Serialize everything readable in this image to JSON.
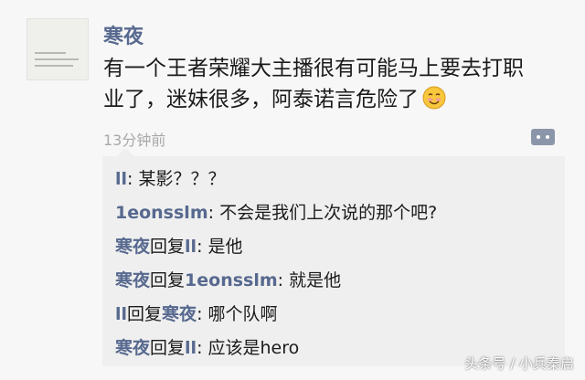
{
  "post": {
    "username": "寒夜",
    "text": "有一个王者荣耀大主播很有可能马上要去打职业了，迷妹很多，阿泰诺言危险了",
    "time": "13分钟前"
  },
  "comments": [
    {
      "name": "ll",
      "reply_word": "",
      "target": "",
      "colon": ": ",
      "text": "某影？？？"
    },
    {
      "name": "1eonsslm",
      "reply_word": "",
      "target": "",
      "colon": ": ",
      "text": "不会是我们上次说的那个吧?"
    },
    {
      "name": "寒夜",
      "reply_word": "回复",
      "target": "ll",
      "colon": ": ",
      "text": "是他"
    },
    {
      "name": "寒夜",
      "reply_word": "回复",
      "target": "1eonsslm",
      "colon": ": ",
      "text": "就是他"
    },
    {
      "name": "ll",
      "reply_word": "回复",
      "target": "寒夜",
      "colon": ": ",
      "text": "哪个队啊"
    },
    {
      "name": "寒夜",
      "reply_word": "回复",
      "target": "ll",
      "colon": ": ",
      "text": "应该是hero"
    }
  ],
  "watermark": "头条号 / 小兵秦启",
  "icons": {
    "avatar": "avatar-image",
    "emoji": "smiling-face-emoji",
    "comment": "comment-bubble-icon"
  },
  "colors": {
    "name": "#57698f",
    "text": "#1b1b1b",
    "time": "#a8a8a8",
    "comment_bg": "#efefef"
  }
}
